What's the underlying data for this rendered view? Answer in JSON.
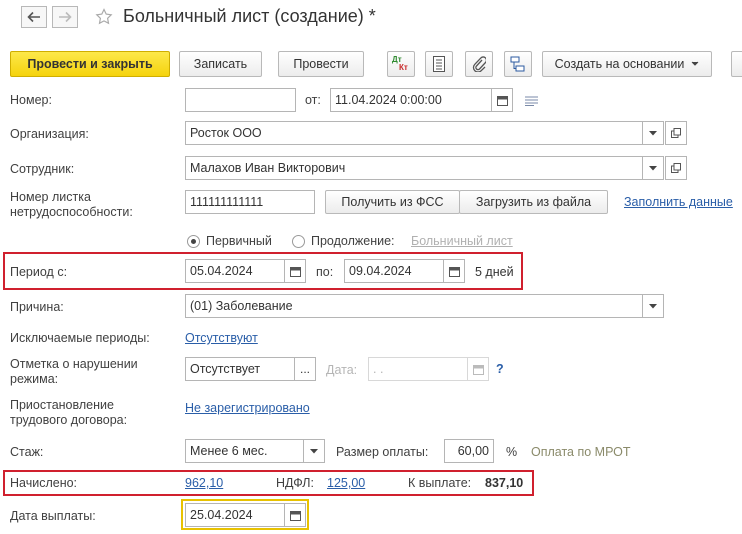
{
  "title": "Больничный лист (создание) *",
  "toolbar": {
    "post_close": "Провести и закрыть",
    "save": "Записать",
    "post": "Провести",
    "dt_kt_top": "Дт",
    "dt_kt_bottom": "Кт",
    "create_based": "Создать на основании"
  },
  "number": {
    "label": "Номер:",
    "value": ""
  },
  "date": {
    "label": "от:",
    "value": "11.04.2024  0:00:00"
  },
  "organization": {
    "label": "Организация:",
    "value": "Росток ООО"
  },
  "employee": {
    "label": "Сотрудник:",
    "value": "Малахов Иван Викторович"
  },
  "sheet": {
    "label": "Номер листка нетрудоспособности:",
    "value": "111111111111",
    "get_fss": "Получить из ФСС",
    "load_file": "Загрузить из файла",
    "fill_link": "Заполнить данные"
  },
  "type": {
    "primary": "Первичный",
    "continuation": "Продолжение:",
    "sick_list_link": "Больничный лист",
    "selected": "primary"
  },
  "period": {
    "label": "Период с:",
    "from": "05.04.2024",
    "to_label": "по:",
    "to": "09.04.2024",
    "days": "5 дней"
  },
  "reason": {
    "label": "Причина:",
    "value": "(01) Заболевание"
  },
  "excluded": {
    "label": "Исключаемые периоды:",
    "link": "Отсутствуют"
  },
  "violation": {
    "label": "Отметка о нарушении режима:",
    "value": "Отсутствует",
    "date_label": "Дата:",
    "date_value": " .  .",
    "help": "?"
  },
  "suspension": {
    "label": "Приостановление трудового договора:",
    "link": "Не зарегистрировано"
  },
  "experience": {
    "label": "Стаж:",
    "value": "Менее 6 мес.",
    "pay_label": "Размер оплаты:",
    "pay_value": "60,00",
    "percent": "%",
    "mrot": "Оплата по МРОТ"
  },
  "accrued": {
    "label": "Начислено:",
    "amount": "962,10",
    "ndfl_label": "НДФЛ:",
    "ndfl": "125,00",
    "payout_label": "К выплате:",
    "payout": "837,10"
  },
  "pay_date": {
    "label": "Дата выплаты:",
    "value": "25.04.2024"
  },
  "colors": {
    "highlight": "#d0202e",
    "focus": "#e8c200",
    "link": "#2a5ea8",
    "primary": "#f5d30d"
  }
}
